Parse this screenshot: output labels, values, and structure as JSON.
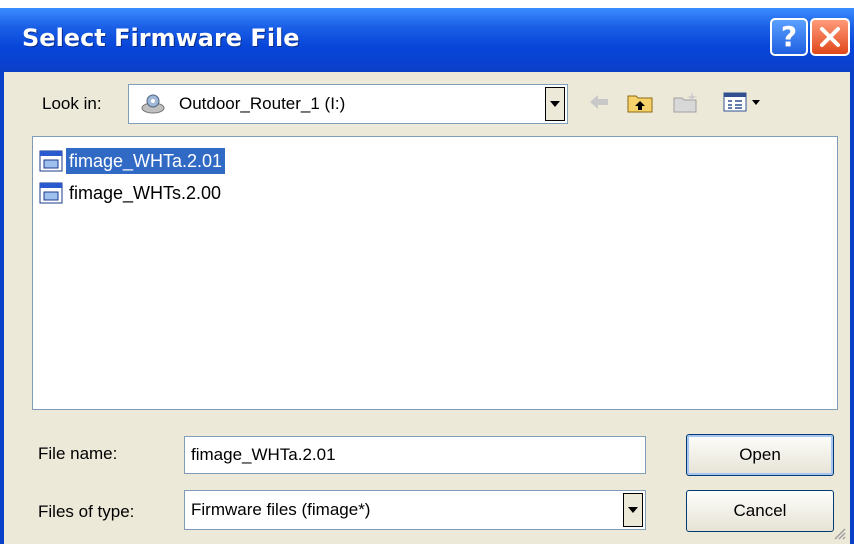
{
  "dialog": {
    "title": "Select Firmware File",
    "help_label": "?",
    "close_label": "✕"
  },
  "look_in": {
    "label": "Look in:",
    "value": "Outdoor_Router_1 (I:)"
  },
  "toolbar": {
    "icons": [
      "back-icon",
      "up-folder-icon",
      "new-folder-icon",
      "view-menu-icon"
    ]
  },
  "files": [
    {
      "name": "fimage_WHTa.2.01",
      "selected": true
    },
    {
      "name": "fimage_WHTs.2.00",
      "selected": false
    }
  ],
  "file_name": {
    "label": "File name:",
    "value": "fimage_WHTa.2.01"
  },
  "file_type": {
    "label": "Files of type:",
    "value": "Firmware files (fimage*)"
  },
  "buttons": {
    "open": "Open",
    "cancel": "Cancel"
  },
  "colors": {
    "titlebar": "#0a3fc8",
    "selection": "#316ac5",
    "dialog_bg": "#ece9d8"
  }
}
